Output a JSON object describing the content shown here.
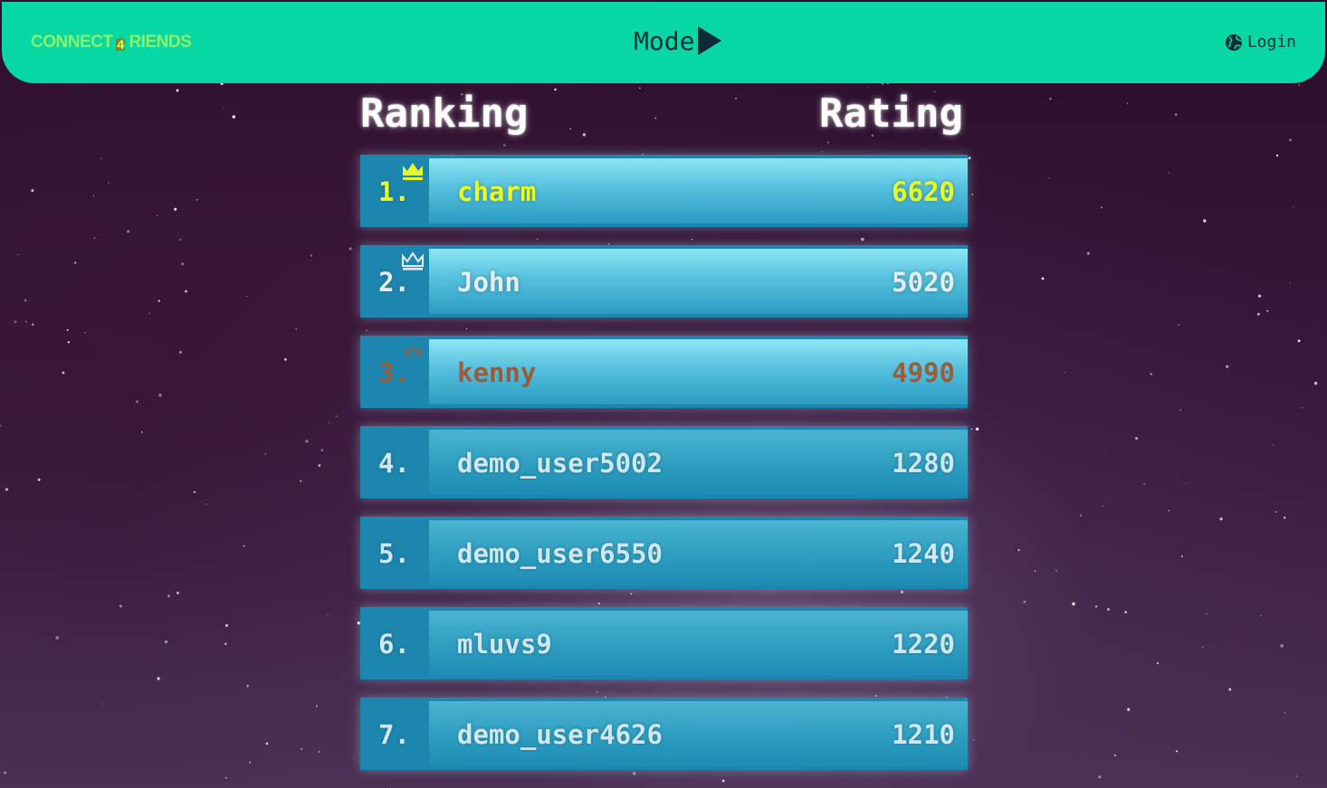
{
  "header": {
    "brand_pre": "CONNECT",
    "brand_num": "4",
    "brand_post": "RIENDS",
    "mode_label": "Mode",
    "login_label": "Login"
  },
  "columns": {
    "ranking": "Ranking",
    "rating": "Rating"
  },
  "leaderboard": [
    {
      "rank": "1.",
      "name": "charm",
      "rating": "6620",
      "tier": "gold"
    },
    {
      "rank": "2.",
      "name": "John",
      "rating": "5020",
      "tier": "silver"
    },
    {
      "rank": "3.",
      "name": "kenny",
      "rating": "4990",
      "tier": "bronze"
    },
    {
      "rank": "4.",
      "name": "demo_user5002",
      "rating": "1280",
      "tier": "none"
    },
    {
      "rank": "5.",
      "name": "demo_user6550",
      "rating": "1240",
      "tier": "none"
    },
    {
      "rank": "6.",
      "name": "mluvs9",
      "rating": "1220",
      "tier": "none"
    },
    {
      "rank": "7.",
      "name": "demo_user4626",
      "rating": "1210",
      "tier": "none"
    }
  ],
  "icons": {
    "brand": "puzzle-piece-icon",
    "mode": "play-triangle-icon",
    "login": "globe-icon",
    "crown": "crown-icon"
  },
  "colors": {
    "header_bg": "#07d8a3",
    "brand_text": "#8bf06a",
    "gold": "#e9ff1f",
    "silver": "#e4eef2",
    "bronze": "#9a5c3a",
    "row_bg": "#1c86ae"
  }
}
